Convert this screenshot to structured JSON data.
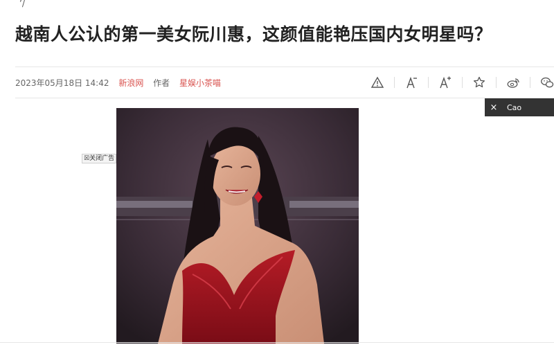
{
  "top_mark": "’/",
  "article": {
    "title": "越南人公认的第一美女阮川惠，这颜值能艳压国内女明星吗？",
    "date": "2023年05月18日 14:42",
    "source": "新浪网",
    "author_label": "作者",
    "author": "星娱小茶喵",
    "accent_color": "#d9534f"
  },
  "toolbar": {
    "icons": [
      "warning-icon",
      "font-decrease-icon",
      "font-increase-icon",
      "star-icon",
      "weibo-icon",
      "wechat-icon"
    ]
  },
  "user_chip": {
    "close": "×",
    "name": "Cao"
  },
  "ad": {
    "close_label": "☒关闭广告"
  },
  "image": {
    "subject": "woman-in-red-gown"
  }
}
